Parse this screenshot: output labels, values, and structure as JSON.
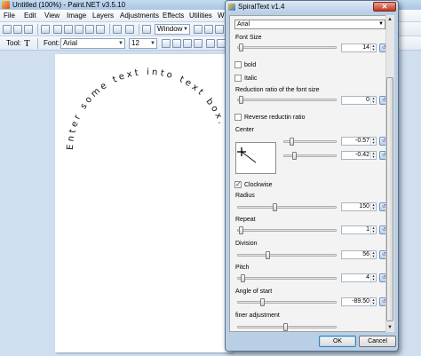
{
  "app": {
    "title": "Untitled (100%) - Paint.NET v3.5.10",
    "menu": [
      "File",
      "Edit",
      "View",
      "Image",
      "Layers",
      "Adjustments",
      "Effects",
      "Utilities",
      "W"
    ],
    "toolbar": {
      "window_combo": "Window",
      "tool_label": "Tool:",
      "tool_value": "T",
      "font_label": "Font:",
      "font_value": "Arial",
      "size_value": "12"
    },
    "canvas_text": "Enter some text into text box."
  },
  "dialog": {
    "title": "SpiralText v1.4",
    "close_label": "✕",
    "font_value": "Arial",
    "font_size_label": "Font Size",
    "font_size_value": "14",
    "bold_label": "bold",
    "italic_label": "Italic",
    "reduction_label": "Reduction ratio of the font size",
    "reduction_value": "0",
    "reverse_label": "Reverse reductin ratio",
    "center_label": "Center",
    "center_x_value": "-0.57",
    "center_y_value": "-0.42",
    "clockwise_label": "Clockwise",
    "radius_label": "Radius",
    "radius_value": "150",
    "repeat_label": "Repeat",
    "repeat_value": "1",
    "division_label": "Division",
    "division_value": "56",
    "pitch_label": "Pitch",
    "pitch_value": "4",
    "angle_label": "Angle of start",
    "angle_value": "-89.50",
    "finer_label": "finer adjustment",
    "ok_label": "OK",
    "cancel_label": "Cancel",
    "checkbox_states": {
      "bold": false,
      "italic": false,
      "reverse": false,
      "clockwise": true
    }
  },
  "colors": {
    "workspace": "#cfdff0",
    "dialog_frame": "#b9cfe6",
    "close_button": "#c23a22"
  }
}
